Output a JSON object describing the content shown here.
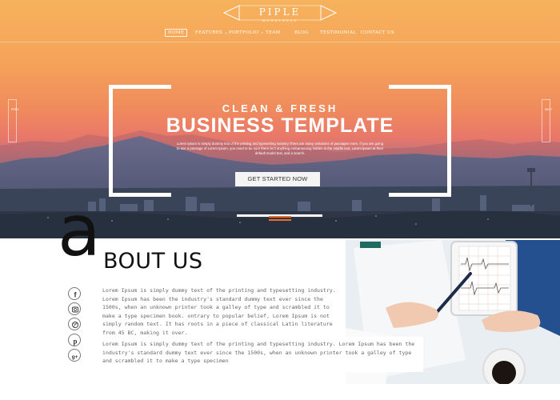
{
  "brand": {
    "name": "PIPLE",
    "tagline": "WORDPRESS"
  },
  "nav": {
    "items": [
      {
        "label": "HOME",
        "active": true
      },
      {
        "label": "FEATURES",
        "has_dropdown": true
      },
      {
        "label": "PORTFOLIO",
        "has_dropdown": true
      },
      {
        "label": "TEAM"
      },
      {
        "label": "BLOG"
      },
      {
        "label": "TESTIMONIAL"
      },
      {
        "label": "CONTACT US"
      }
    ]
  },
  "hero": {
    "prev_label": "PREV",
    "next_label": "NEXT",
    "subtitle": "CLEAN & FRESH",
    "title": "BUSINESS TEMPLATE",
    "description": "Lorem Ipsum is simply dummy text of the printing and typesetting industry.There are many variations of passages more. If you are going to use a passage of Lorem Ipsum, you need to be sure there isn't anything embarrassing hidden in the middle text. Lorem Ipsum at their default model text, and a search.",
    "cta_label": "GET STARTED NOW",
    "colors": {
      "accent": "#e96f2a",
      "sky_top": "#f6b25c",
      "sky_mid": "#f08c5c",
      "mountains": "#4a5770"
    }
  },
  "about": {
    "big_letter": "a",
    "title": "BOUT US",
    "paragraph_1": "Lorem Ipsum is simply dummy text of the printing and typesetting industry. Lorem Ipsum has been the industry's standard dummy text ever since the 1500s, when an unknown printer took a galley of type and scrambled it to make a type specimen book. ontrary to popular belief, Lorem Ipsum is not simply random text. It has roots in a piece of classical Latin literature from 45 BC, making it over.",
    "paragraph_2": "Lorem Ipsum is simply dummy text of the printing and typesetting industry. Lorem Ipsum has been the industry's standard dummy text ever since the 1500s, when an unknown printer took a galley of type and scrambled it to make a type specimen",
    "social_icons": [
      "facebook-icon",
      "instagram-icon",
      "dribbble-icon",
      "pinterest-icon",
      "google-plus-icon"
    ],
    "image": "hands-with-tablet-and-pen-photo"
  }
}
